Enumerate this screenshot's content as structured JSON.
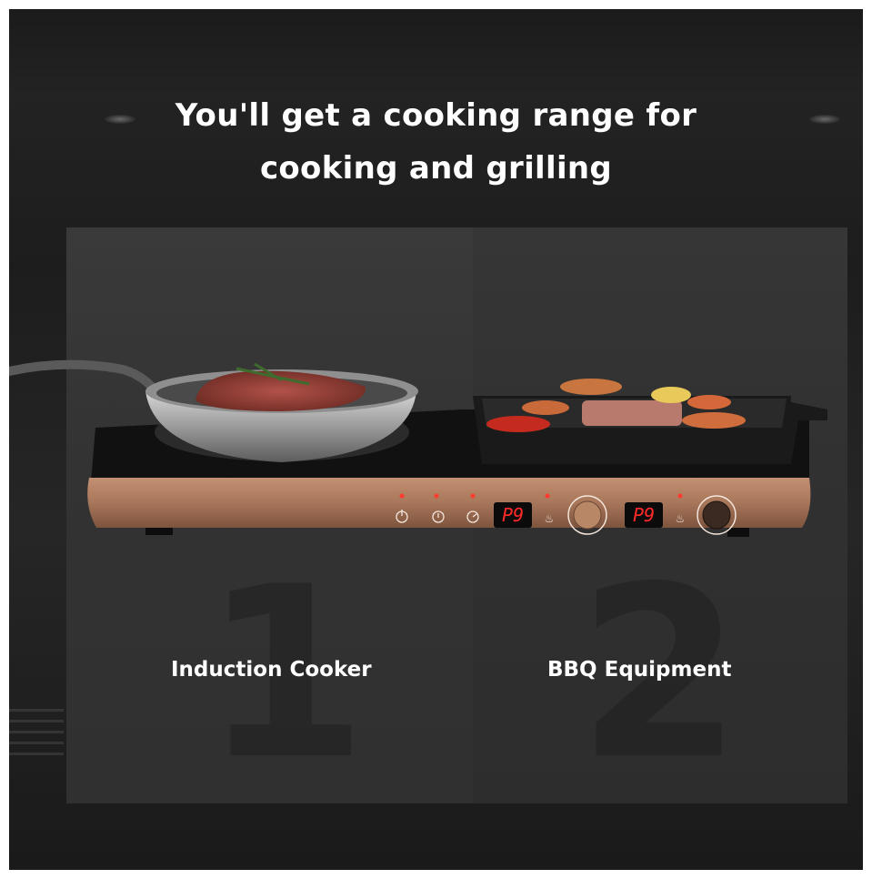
{
  "headline": {
    "line1": "You'll get a cooking range for",
    "line2": "cooking and grilling"
  },
  "panels": [
    {
      "number": "1",
      "label": "Induction Cooker"
    },
    {
      "number": "2",
      "label": "BBQ Equipment"
    }
  ],
  "control_panel": {
    "display_left": "P9",
    "display_right": "P9"
  },
  "colors": {
    "background": "#1f1f1f",
    "panel": "#333333",
    "copper": "#b07d5e",
    "display_red": "#ff2a2a"
  },
  "icons": [
    "power-icon",
    "timer-icon",
    "lock-icon",
    "flame-icon",
    "knob-icon"
  ]
}
